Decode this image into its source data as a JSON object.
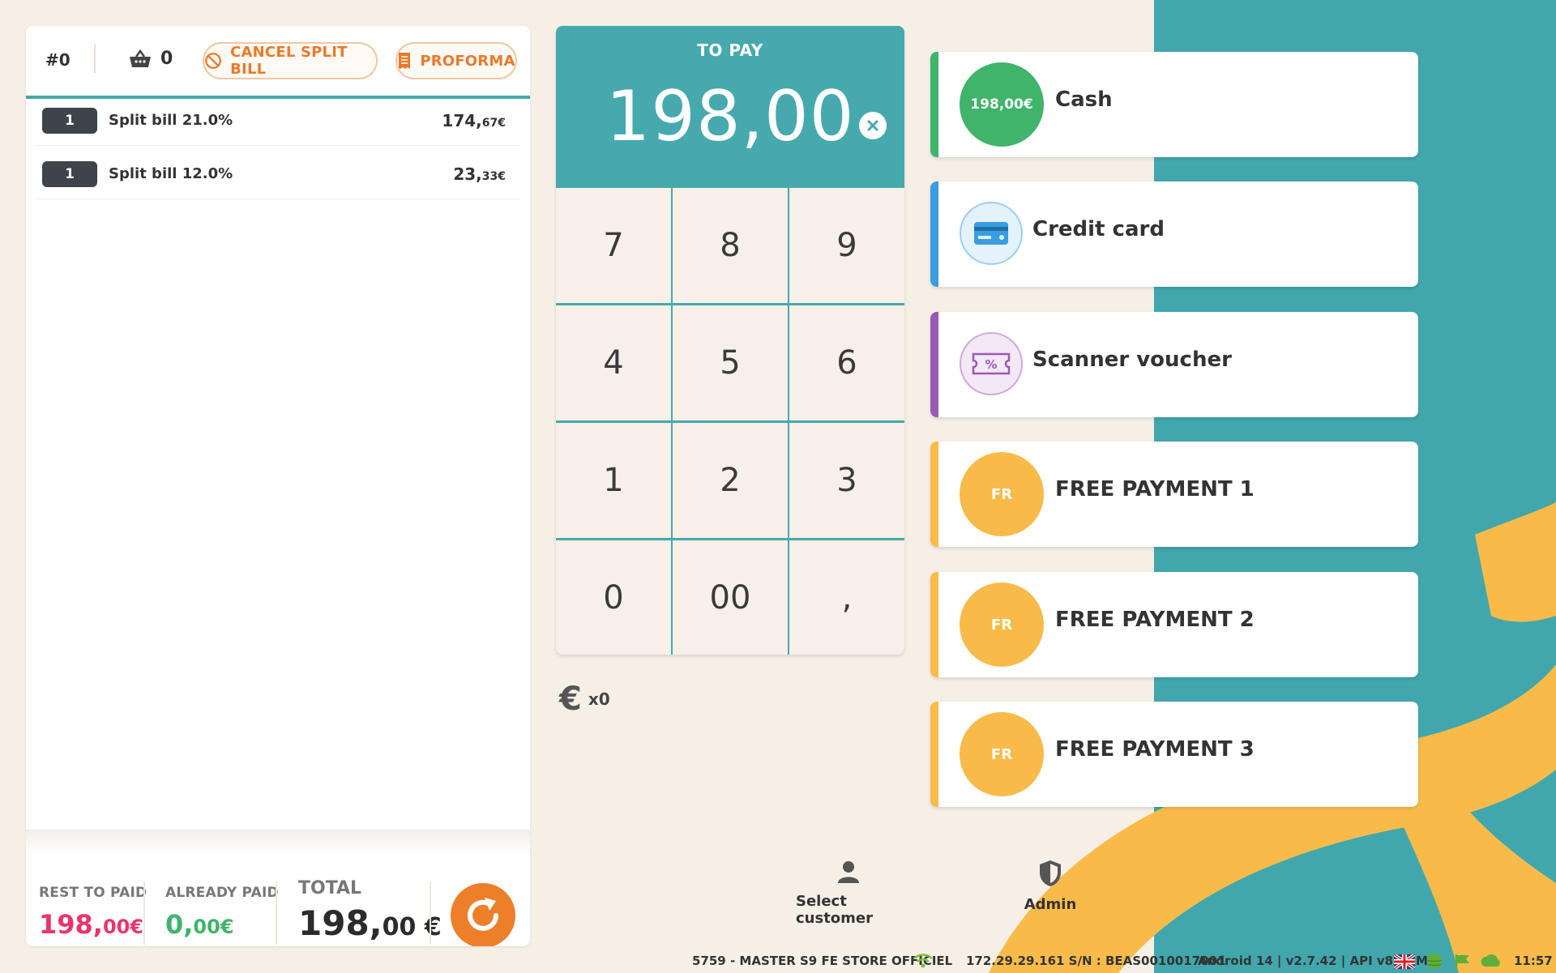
{
  "order": {
    "number": "#0",
    "basket_count": "0"
  },
  "header_buttons": {
    "cancel_split_bill": "CANCEL SPLIT BILL",
    "proforma": "PROFORMA"
  },
  "bill_lines": [
    {
      "qty": "1",
      "label": "Split bill 21.0%",
      "amount_int": "174,",
      "amount_dec": "67€"
    },
    {
      "qty": "1",
      "label": "Split bill 12.0%",
      "amount_int": "23,",
      "amount_dec": "33€"
    }
  ],
  "footer": {
    "rest_label": "REST TO PAID",
    "rest_int": "198,",
    "rest_dec": "00€",
    "already_label": "ALREADY PAID",
    "already_int": "0,",
    "already_dec": "00€",
    "total_label": "TOTAL",
    "total_int": "198,",
    "total_dec": "00 €"
  },
  "keypad": {
    "title": "TO PAY",
    "amount": "198,00",
    "keys": [
      "7",
      "8",
      "9",
      "4",
      "5",
      "6",
      "1",
      "2",
      "3",
      "0",
      "00",
      ","
    ]
  },
  "multiplier": {
    "symbol": "€",
    "value": "x0"
  },
  "payments": [
    {
      "label": "Cash",
      "circle_text": "198,00€",
      "color": "#3fb46a",
      "icon": "amount-circle"
    },
    {
      "label": "Credit card",
      "circle_text": "",
      "color": "#3a9de0",
      "icon": "credit-card-icon"
    },
    {
      "label": "Scanner voucher",
      "circle_text": "",
      "color": "#9b59b6",
      "icon": "voucher-icon"
    },
    {
      "label": "FREE PAYMENT 1",
      "circle_text": "FR",
      "color": "#f8bb4a",
      "icon": "fr-circle"
    },
    {
      "label": "FREE PAYMENT 2",
      "circle_text": "FR",
      "color": "#f8bb4a",
      "icon": "fr-circle"
    },
    {
      "label": "FREE PAYMENT 3",
      "circle_text": "FR",
      "color": "#f8bb4a",
      "icon": "fr-circle"
    }
  ],
  "bottom_actions": {
    "select_customer": "Select customer",
    "admin": "Admin"
  },
  "status_bar": {
    "store": "5759 -  MASTER S9 FE STORE OFFICIEL",
    "network": "172.29.29.161  S/N : BEAS0010017001",
    "system": "Android 14  |  v2.7.42 | API v8 FDM",
    "time": "11:57"
  },
  "colors": {
    "teal": "#46a9ae",
    "orange": "#ee7f2a",
    "pink": "#e8356d",
    "green": "#3fb46a",
    "yellow": "#f8bb4a"
  }
}
